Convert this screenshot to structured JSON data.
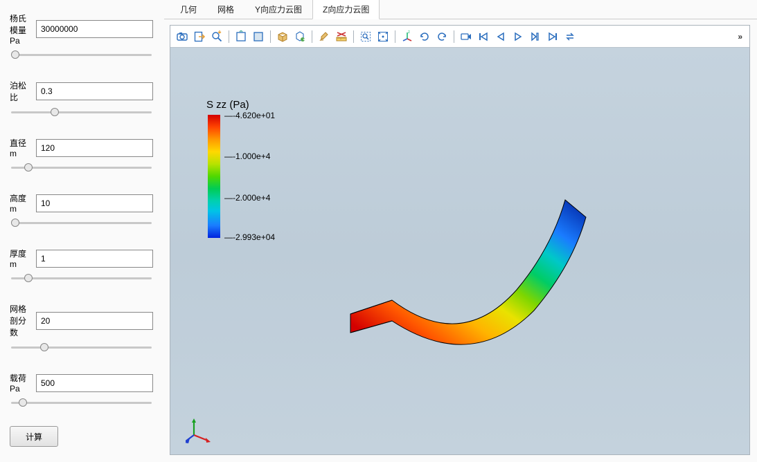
{
  "sidebar": {
    "params": [
      {
        "label": "杨氏模量 Pa",
        "value": "30000000",
        "slider": 0
      },
      {
        "label": "泊松比",
        "value": "0.3",
        "slider": 30
      },
      {
        "label": "直径 m",
        "value": "120",
        "slider": 10
      },
      {
        "label": "高度 m",
        "value": "10",
        "slider": 0
      },
      {
        "label": "厚度 m",
        "value": "1",
        "slider": 10
      },
      {
        "label": "网格剖分数",
        "value": "20",
        "slider": 22
      },
      {
        "label": "载荷 Pa",
        "value": "500",
        "slider": 6
      }
    ],
    "calc_label": "计算"
  },
  "tabs": {
    "items": [
      "几何",
      "网格",
      "Y向应力云图",
      "Z向应力云图"
    ],
    "active_index": 3
  },
  "toolbar": {
    "icons": [
      "camera-icon",
      "export-icon",
      "zoom-auto-icon",
      "sep",
      "select-rect-icon",
      "deselect-icon",
      "sep",
      "box-view-icon",
      "visibility-icon",
      "sep",
      "clean-icon",
      "ruler-icon",
      "sep",
      "zoom-window-icon",
      "fit-all-icon",
      "sep",
      "axes-xyz-icon",
      "rotate-ccw-icon",
      "rotate-cw-icon",
      "sep",
      "record-icon",
      "first-frame-icon",
      "prev-frame-icon",
      "play-icon",
      "next-step-icon",
      "last-frame-icon",
      "loop-icon"
    ],
    "more": "»"
  },
  "legend": {
    "title": "S zz (Pa)",
    "ticks": [
      {
        "text": "-4.620e+01",
        "pos_pct": 0
      },
      {
        "text": "-1.000e+4",
        "pos_pct": 33
      },
      {
        "text": "-2.000e+4",
        "pos_pct": 67
      },
      {
        "text": "-2.993e+04",
        "pos_pct": 100
      }
    ]
  },
  "chart_data": {
    "type": "heatmap",
    "title": "S zz (Pa)",
    "field": "S_zz",
    "units": "Pa",
    "color_scale": "rainbow_reversed",
    "range": [
      -29930,
      -46.2
    ],
    "colorbar_ticks": [
      -46.2,
      -10000,
      -20000,
      -29930
    ],
    "geometry": "curved shell strip (sector), 3D perspective",
    "notes": "Red ≈ max (near -46 Pa) at fixed/left end; Blue ≈ min (≈ -2.99e4 Pa) at free/right end"
  }
}
